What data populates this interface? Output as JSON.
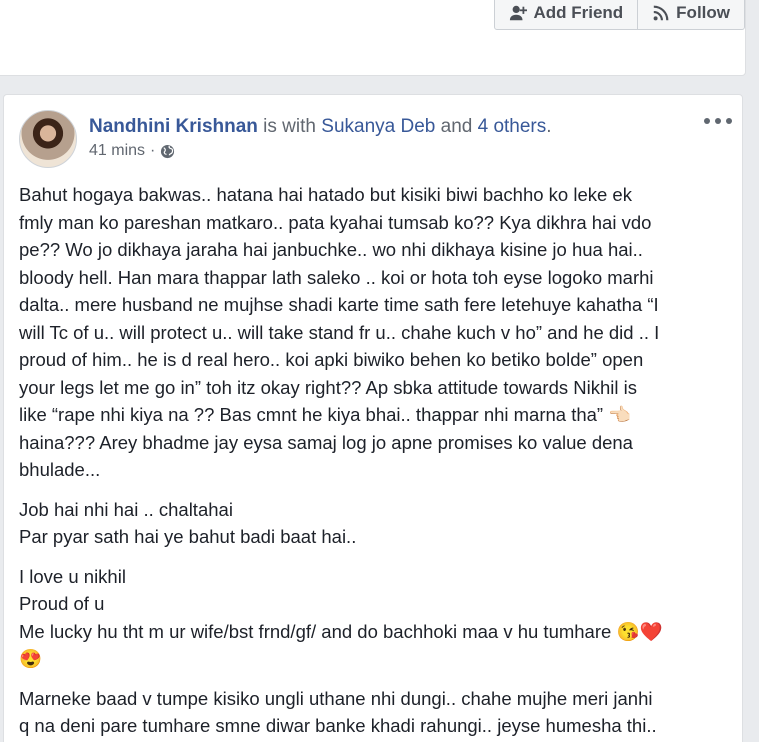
{
  "top_card": {
    "add_friend_label": "Add Friend",
    "follow_label": "Follow",
    "add_friend_icon": "add-friend-icon",
    "follow_icon": "rss-icon"
  },
  "post": {
    "author": "Nandhini Krishnan",
    "with_text": " is with ",
    "tagged": "Sukanya Deb",
    "and_text": " and ",
    "others": "4 others",
    "period": ".",
    "time": "41 mins",
    "separator": "·",
    "audience_icon": "globe-icon",
    "paragraphs": [
      [
        "Bahut hogaya bakwas.. hatana hai hatado but kisiki biwi bachho ko leke ek",
        "fmly man ko pareshan matkaro.. pata kyahai tumsab ko?? Kya dikhra hai vdo",
        "pe?? Wo jo dikhaya jaraha hai janbuchke.. wo nhi dikhaya kisine jo hua hai..",
        "bloody hell. Han mara thappar lath saleko .. koi or hota toh eyse logoko marhi",
        "dalta.. mere husband ne mujhse shadi karte time sath fere letehuye kahatha “I",
        "will Tc of u.. will protect u.. will take stand fr u.. chahe kuch v ho” and he did .. I",
        "proud of him.. he is d real hero.. koi apki biwiko behen ko betiko bolde” open",
        "your legs let me go in” toh itz okay right?? Ap sbka attitude towards Nikhil is",
        "like “rape nhi kiya na ?? Bas cmnt he kiya bhai.. thappar nhi marna tha” 👈🏻",
        "haina??? Arey bhadme jay eysa samaj log jo apne promises ko value dena",
        "bhulade..."
      ],
      [
        "Job hai nhi hai .. chaltahai",
        "Par pyar sath hai ye bahut badi baat hai.."
      ],
      [
        "I love u nikhil",
        "Proud of u",
        "Me lucky hu tht m ur wife/bst frnd/gf/ and do bachhoki maa v hu tumhare 😘❤️",
        "😍"
      ],
      [
        "Marneke baad v tumpe kisiko ungli uthane nhi dungi.. chahe mujhe meri janhi",
        "q na deni pare tumhare smne diwar banke khadi rahungi.. jeyse humesha thi.."
      ]
    ]
  }
}
